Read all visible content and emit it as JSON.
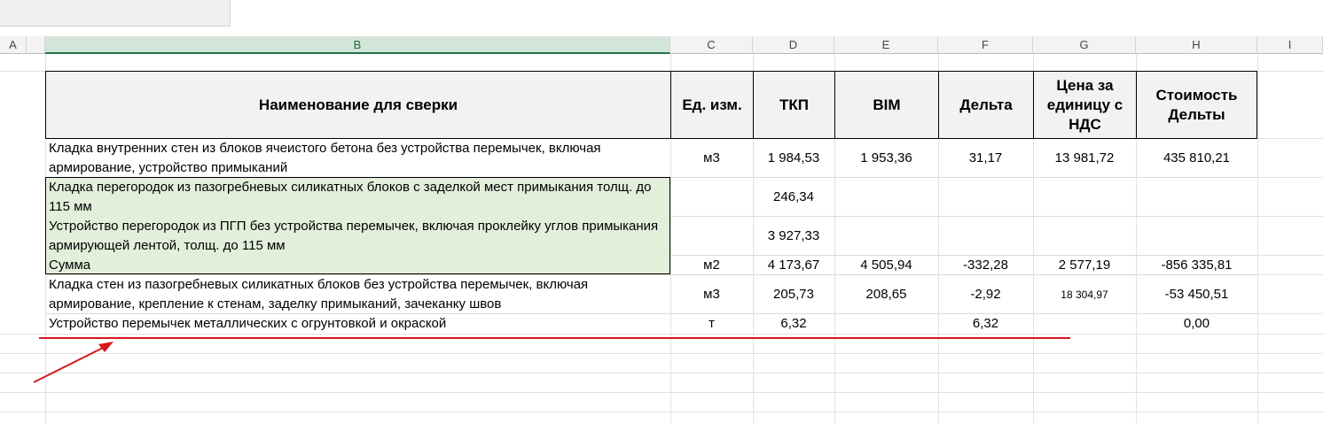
{
  "columns": [
    "A",
    "B",
    "C",
    "D",
    "E",
    "F",
    "G",
    "H",
    "I"
  ],
  "header": {
    "name": "Наименование для сверки",
    "unit": "Ед. изм.",
    "tkp": "ТКП",
    "bim": "BIM",
    "delta": "Дельта",
    "price": "Цена за единицу с НДС",
    "cost": "Стоимость Дельты"
  },
  "rows": [
    {
      "name": "Кладка внутренних стен из блоков ячеистого бетона без устройства перемычек, включая армирование, устройство примыканий",
      "unit": "м3",
      "tkp": "1 984,53",
      "bim": "1 953,36",
      "delta": "31,17",
      "price": "13 981,72",
      "cost": "435 810,21"
    },
    {
      "name": "Кладка перегородок из пазогребневых силикатных блоков с заделкой мест примыкания толщ. до 115 мм",
      "unit": "",
      "tkp": "246,34",
      "bim": "",
      "delta": "",
      "price": "",
      "cost": ""
    },
    {
      "name": "Устройство перегородок из ПГП без устройства перемычек, включая проклейку углов примыкания армирующей лентой, толщ. до 115 мм",
      "unit": "",
      "tkp": "3 927,33",
      "bim": "",
      "delta": "",
      "price": "",
      "cost": ""
    },
    {
      "name": "Сумма",
      "unit": "м2",
      "tkp": "4 173,67",
      "bim": "4 505,94",
      "delta": "-332,28",
      "price": "2 577,19",
      "cost": "-856 335,81"
    },
    {
      "name": "Кладка стен из пазогребневых силикатных блоков без устройства перемычек, включая армирование, крепление к стенам, заделку примыканий, зачеканку швов",
      "unit": "м3",
      "tkp": "205,73",
      "bim": "208,65",
      "delta": "-2,92",
      "price": "18 304,97",
      "cost": "-53 450,51"
    },
    {
      "name": "Устройство перемычек металлических с огрунтовкой и окраской",
      "unit": "т",
      "tkp": "6,32",
      "bim": "",
      "delta": "6,32",
      "price": "",
      "cost": "0,00"
    }
  ],
  "annotation_color": "#d9151b"
}
